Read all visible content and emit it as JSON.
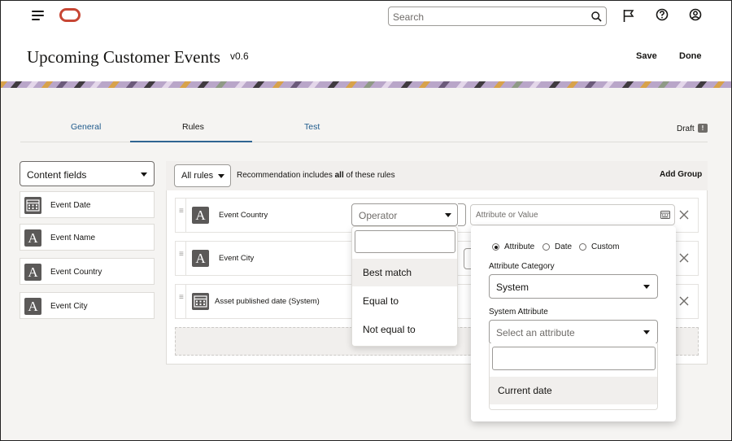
{
  "topbar": {
    "search_placeholder": "Search",
    "icons": [
      "hamburger-menu-icon",
      "oracle-logo",
      "search-icon",
      "flag-icon",
      "help-icon",
      "user-profile-icon"
    ]
  },
  "header": {
    "title": "Upcoming Customer Events",
    "version": "v0.6",
    "save_label": "Save",
    "done_label": "Done"
  },
  "tabs": [
    {
      "label": "General"
    },
    {
      "label": "Rules",
      "active": true
    },
    {
      "label": "Test"
    }
  ],
  "status": {
    "label": "Draft",
    "badge": "!"
  },
  "sidebar": {
    "select_label": "Content fields",
    "fields": [
      {
        "label": "Event Date",
        "icon": "calendar-icon"
      },
      {
        "label": "Event Name",
        "icon": "text-icon",
        "glyph": "A"
      },
      {
        "label": "Event Country",
        "icon": "text-icon",
        "glyph": "A"
      },
      {
        "label": "Event City",
        "icon": "text-icon",
        "glyph": "A"
      }
    ]
  },
  "rules_header": {
    "scope_label": "All rules",
    "recommendation_prefix": "Recommendation includes ",
    "recommendation_bold": "all",
    "recommendation_suffix": " of these rules",
    "add_group_label": "Add Group"
  },
  "rules": [
    {
      "label": "Event Country",
      "icon": "text-icon",
      "glyph": "A"
    },
    {
      "label": "Event City",
      "icon": "text-icon",
      "glyph": "A"
    },
    {
      "label": "Asset published date (System)",
      "icon": "calendar-icon"
    }
  ],
  "operator": {
    "placeholder": "Operator",
    "options": [
      "Best match",
      "Equal to",
      "Not equal to"
    ],
    "highlighted": "Best match"
  },
  "value_input": {
    "placeholder": "Attribute or Value"
  },
  "attribute_popup": {
    "radio_options": [
      {
        "label": "Attribute",
        "selected": true
      },
      {
        "label": "Date",
        "selected": false
      },
      {
        "label": "Custom",
        "selected": false
      }
    ],
    "category_label": "Attribute Category",
    "category_value": "System",
    "system_attribute_label": "System Attribute",
    "system_attribute_placeholder": "Select an attribute",
    "attribute_options": [
      "Current date"
    ]
  },
  "colors": {
    "oracle_red": "#c74634",
    "tab_link": "#1e5a8c",
    "active_tab_underline": "#2f6592",
    "icon_tile": "#5b5958"
  }
}
